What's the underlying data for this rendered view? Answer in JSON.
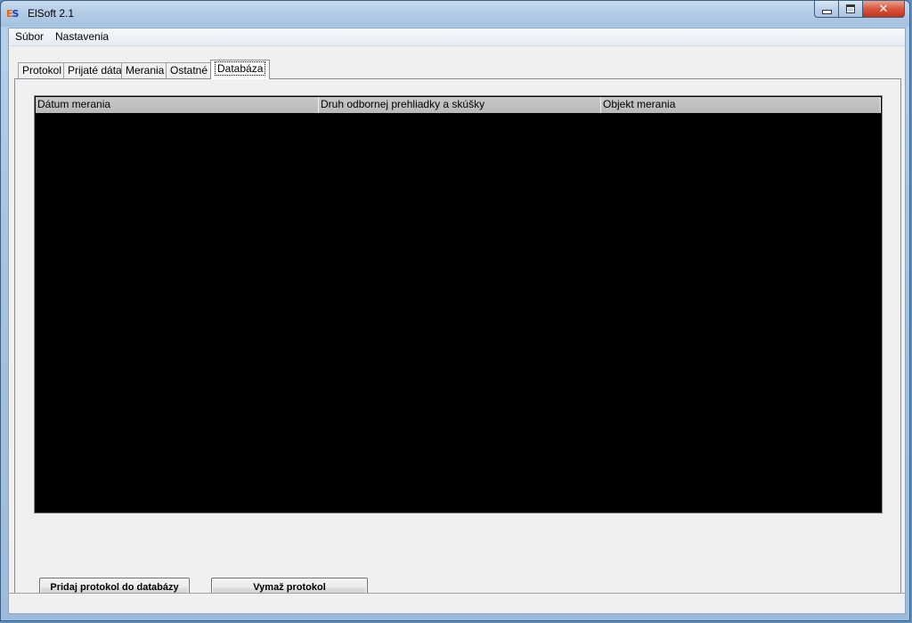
{
  "window": {
    "title": "ElSoft 2.1",
    "logo": {
      "e": "E",
      "s": "S"
    },
    "close_glyph": "✕"
  },
  "menu": [
    {
      "label": "Súbor"
    },
    {
      "label": "Nastavenia"
    }
  ],
  "tabs": [
    {
      "label": "Protokol",
      "active": false
    },
    {
      "label": "Prijaté dáta",
      "active": false
    },
    {
      "label": "Merania",
      "active": false
    },
    {
      "label": "Ostatné",
      "active": false
    },
    {
      "label": "Databáza",
      "active": true
    }
  ],
  "table": {
    "columns": [
      "Dátum merania",
      "Druh odbornej prehliadky a skúšky",
      "Objekt merania"
    ],
    "rows": []
  },
  "buttons": {
    "add_label": "Pridaj protokol do databázy",
    "delete_label": "Vymaž protokol"
  }
}
